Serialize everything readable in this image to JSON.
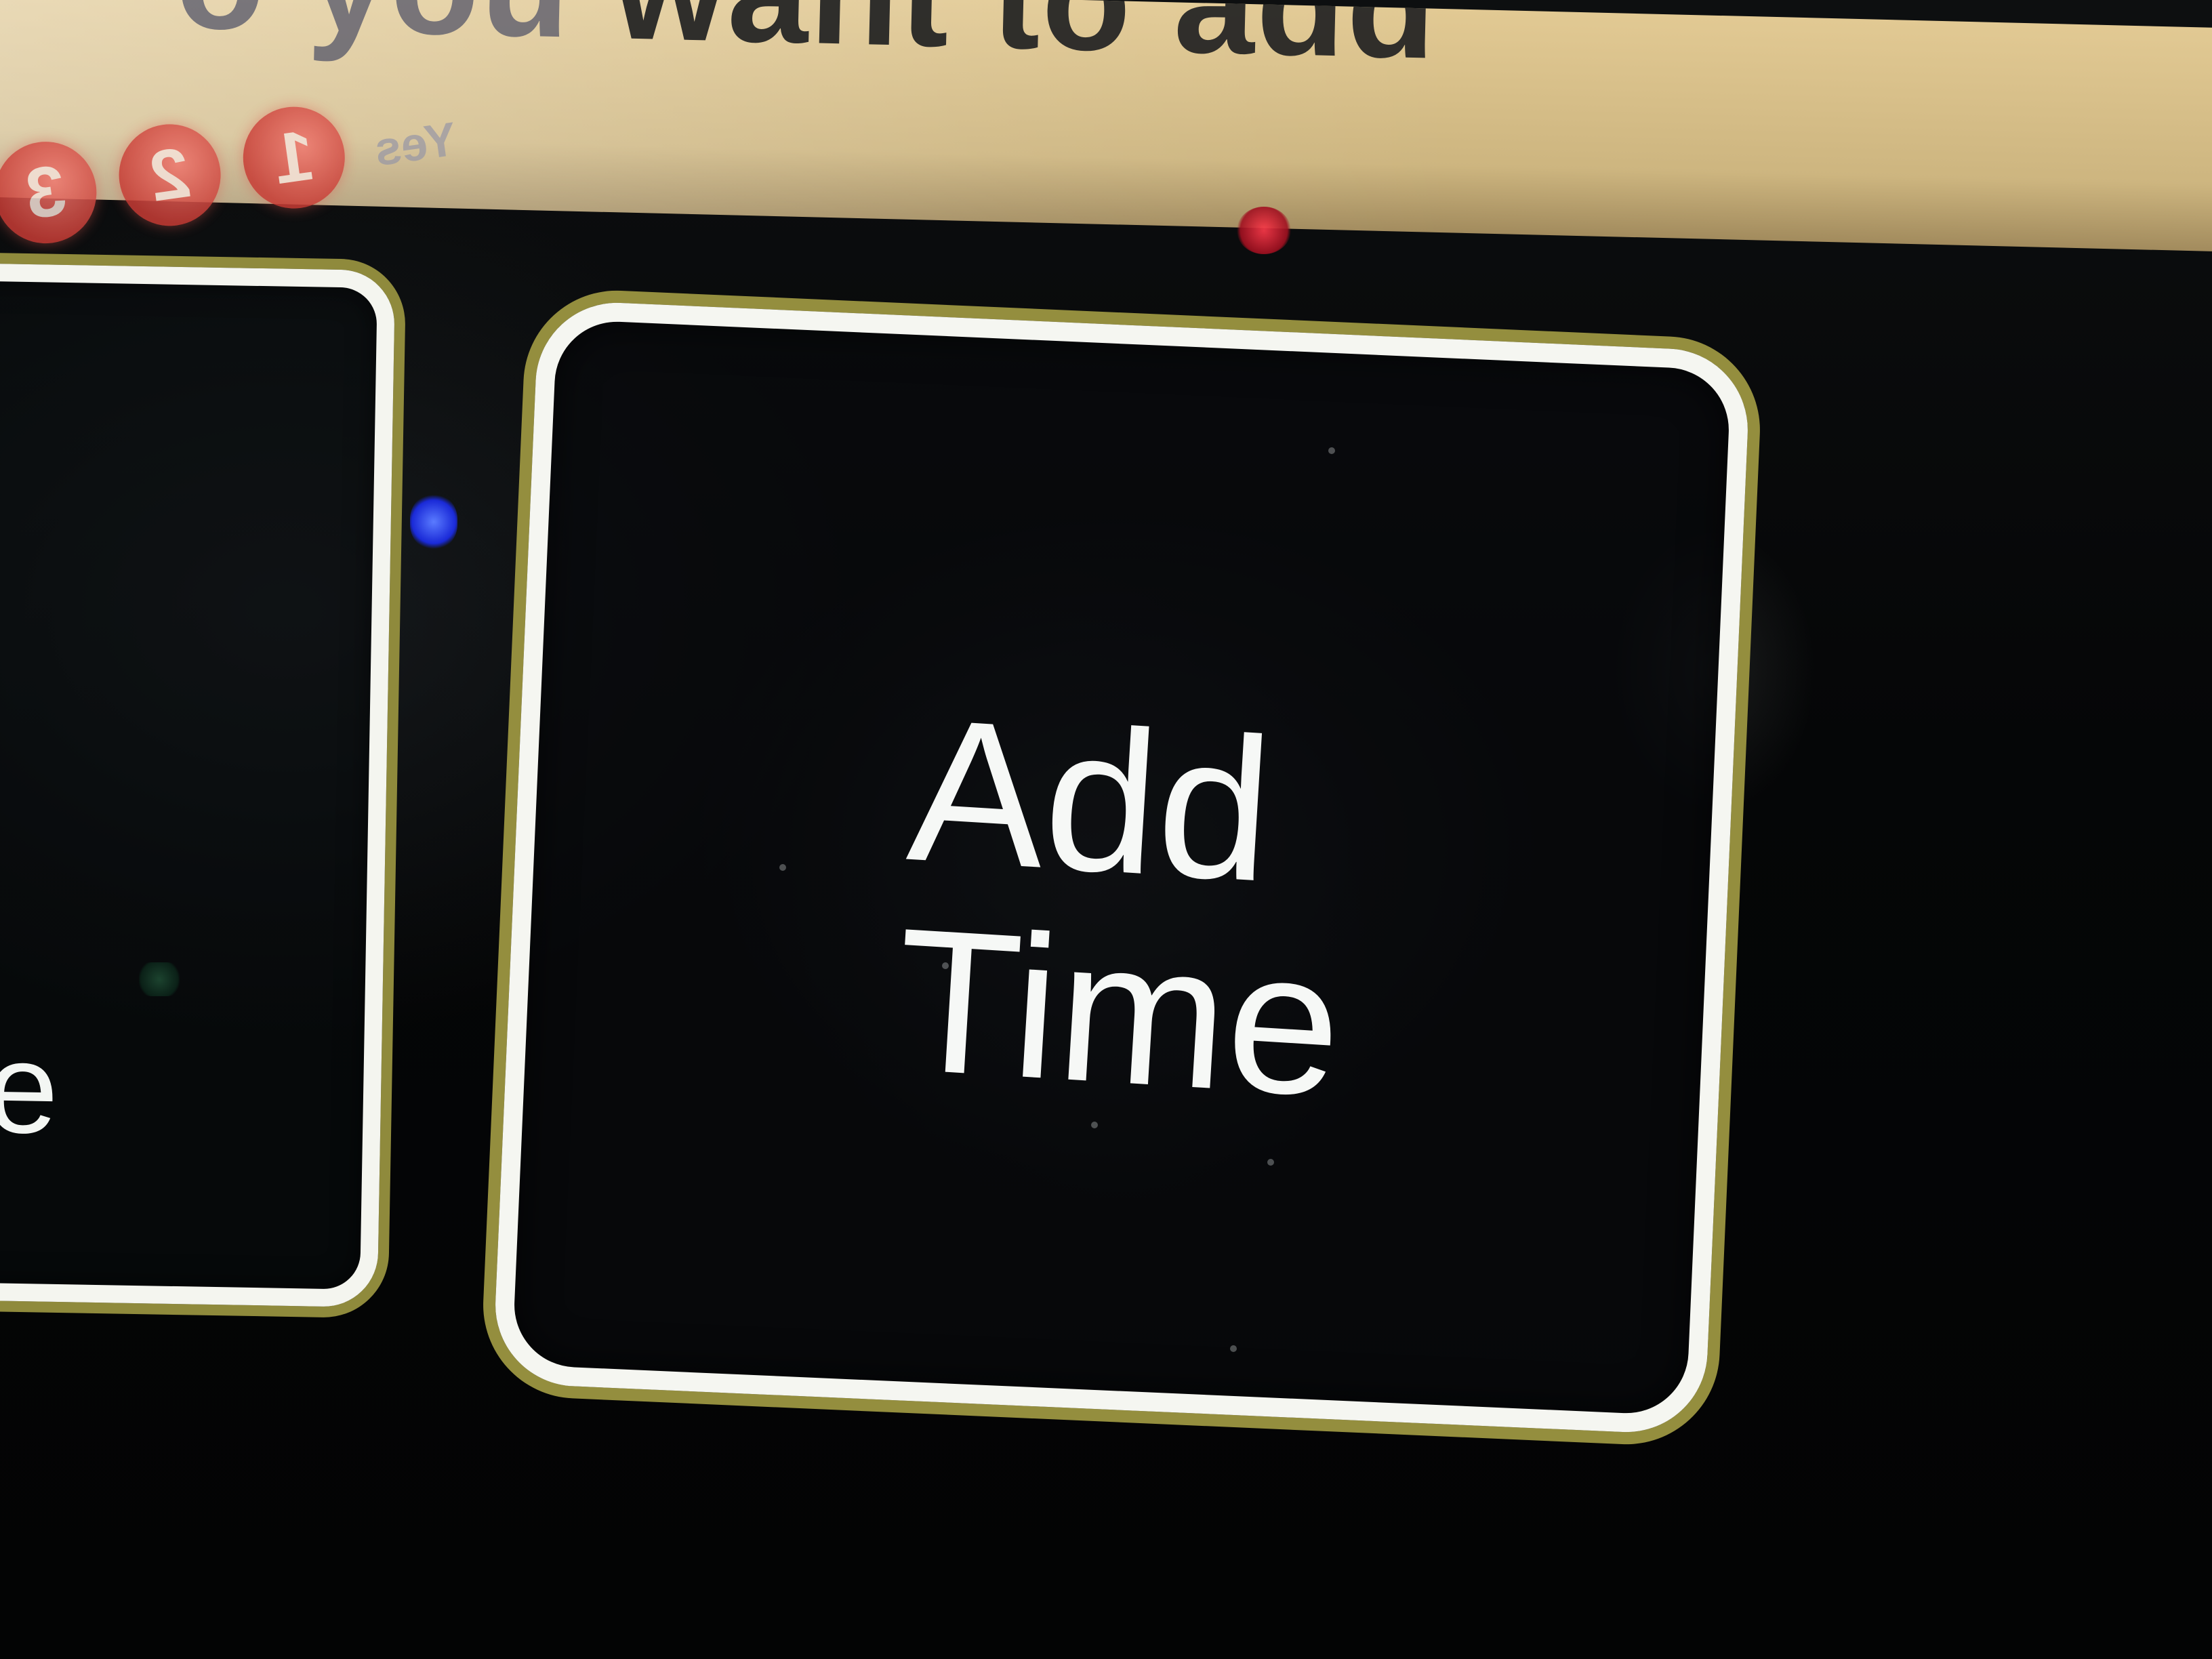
{
  "header": {
    "instruction_visible_faded": "o you",
    "instruction_visible_main": "want to add"
  },
  "steps": {
    "items": [
      "3",
      "2",
      "1"
    ],
    "caption": "Yes"
  },
  "buttons": {
    "left_partial_label": "e",
    "add_time_line1": "Add",
    "add_time_line2": "Time"
  },
  "colors": {
    "banner": "#d9c08a",
    "button_border": "#f5f6f1",
    "button_outline": "#948e3e",
    "step_dot": "#d54a42",
    "screen_bg": "#050607"
  }
}
